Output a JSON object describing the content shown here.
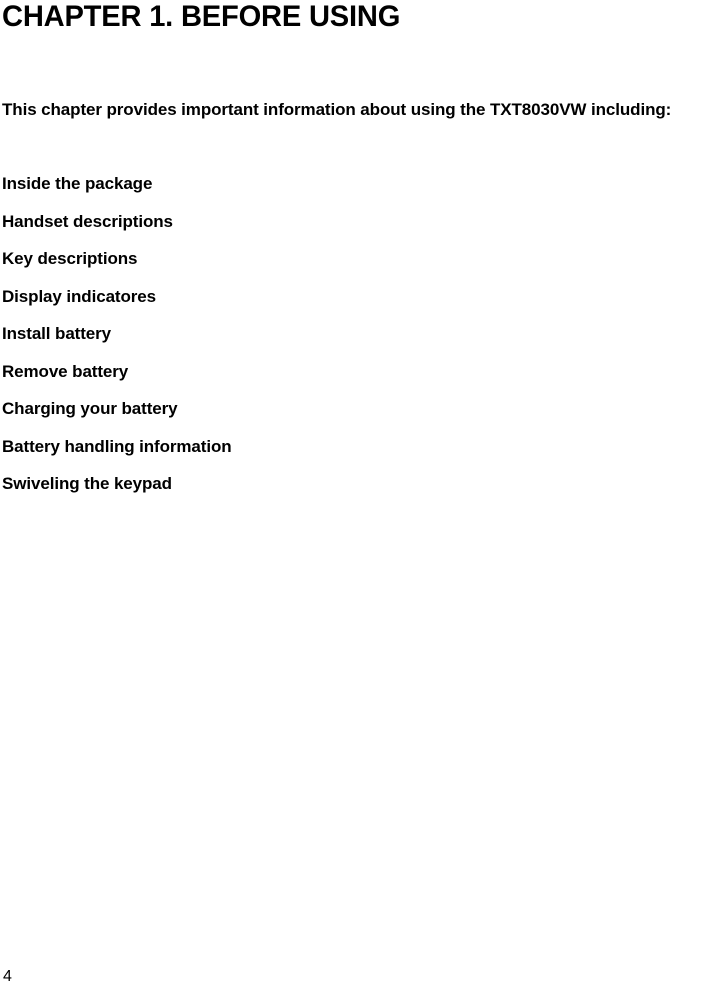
{
  "document": {
    "background_color": "#ffffff",
    "text_color": "#000000",
    "chapter_title": "CHAPTER 1. BEFORE USING",
    "intro_paragraph": "This chapter provides important information about using the TXT8030VW including:",
    "topics": [
      "Inside the package",
      "Handset descriptions",
      "Key descriptions",
      "Display indicatores",
      "Install battery",
      "Remove battery",
      "Charging your battery",
      "Battery handling information",
      "Swiveling the keypad"
    ],
    "page_number": "4"
  }
}
